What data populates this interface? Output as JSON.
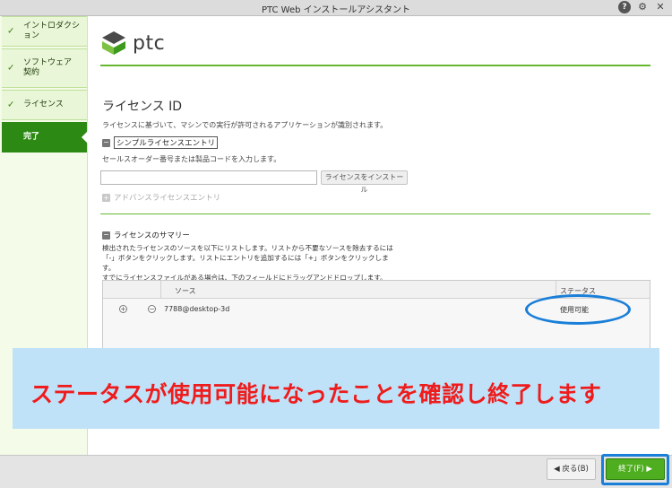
{
  "window": {
    "title": "PTC Web インストールアシスタント",
    "help_label": "?",
    "settings_label": "⚙",
    "close_label": "✕"
  },
  "sidebar": {
    "steps": [
      {
        "label": "イントロダクション",
        "check": "✓"
      },
      {
        "label": "ソフトウェア\n契約",
        "check": "✓"
      },
      {
        "label": "ライセンス",
        "check": "✓"
      },
      {
        "label": "完了"
      }
    ]
  },
  "logo": {
    "text": "ptc"
  },
  "license": {
    "heading": "ライセンス ID",
    "description": "ライセンスに基づいて、マシンでの実行が許可されるアプリケーションが識別されます。",
    "simple_entry_label": "シンプルライセンスエントリ",
    "input_prompt": "セールスオーダー番号または製品コードを入力します。",
    "input_value": "",
    "install_button": "ライセンスをインストール",
    "advanced_entry_label": "アドバンスライセンスエントリ"
  },
  "summary": {
    "heading": "ライセンスのサマリー",
    "lines": [
      "検出されたライセンスのソースを以下にリストします。リストから不要なソースを除去するには",
      "「-」ボタンをクリックします。リストにエントリを追加するには「+」ボタンをクリックします。",
      "すでにライセンスファイルがある場合は、下のフィールドにドラッグアンドドロップします。"
    ],
    "columns": {
      "source": "ソース",
      "status": "ステータス"
    },
    "rows": [
      {
        "source": "7788@desktop-3d",
        "status": "使用可能"
      }
    ]
  },
  "annotation": {
    "banner_text": "ステータスが使用可能になったことを確認し終了します",
    "highlight_color": "#1a7fd8",
    "banner_text_color": "#ee1c1c",
    "banner_bg": "#bfe2f8"
  },
  "footer": {
    "back_label": "◀ 戻る(B)",
    "finish_label": "終了(F) ▶"
  },
  "colors": {
    "accent_green": "#4fae1f",
    "rule_green": "#65b830"
  }
}
